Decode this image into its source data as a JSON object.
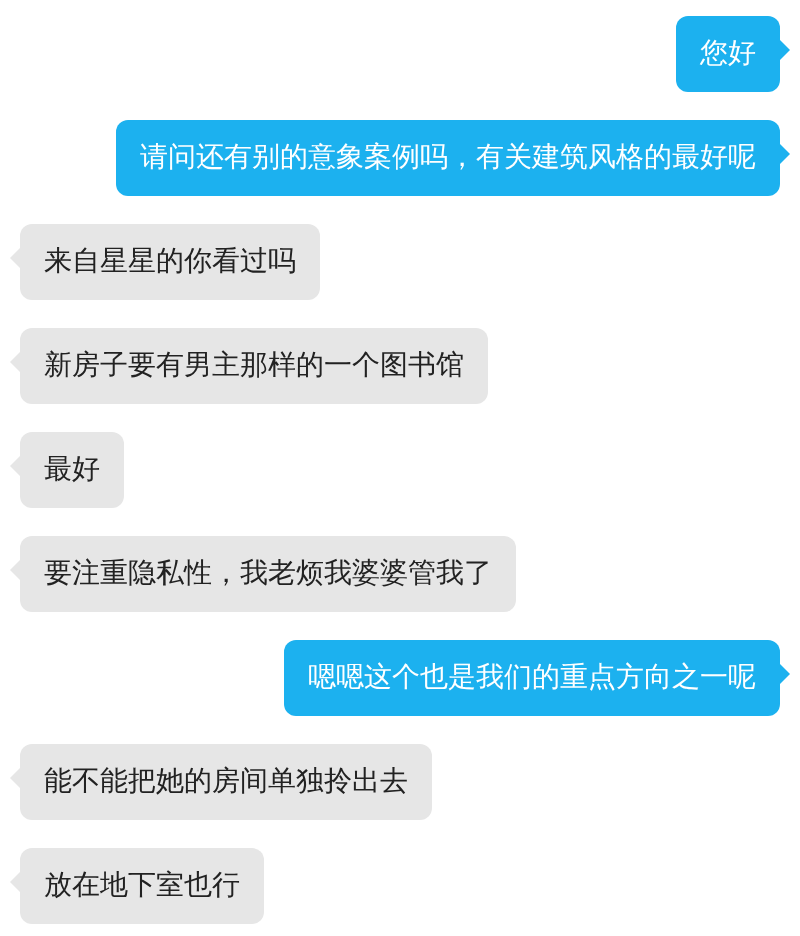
{
  "messages": [
    {
      "kind": "sent",
      "text": "您好"
    },
    {
      "kind": "sent",
      "text": "请问还有别的意象案例吗，有关建筑风格的最好呢"
    },
    {
      "kind": "received",
      "text": "来自星星的你看过吗"
    },
    {
      "kind": "received",
      "text": "新房子要有男主那样的一个图书馆"
    },
    {
      "kind": "received",
      "text": "最好"
    },
    {
      "kind": "received",
      "text": "要注重隐私性，我老烦我婆婆管我了"
    },
    {
      "kind": "sent",
      "text": "嗯嗯这个也是我们的重点方向之一呢"
    },
    {
      "kind": "received",
      "text": "能不能把她的房间单独拎出去"
    },
    {
      "kind": "received",
      "text": "放在地下室也行"
    }
  ]
}
